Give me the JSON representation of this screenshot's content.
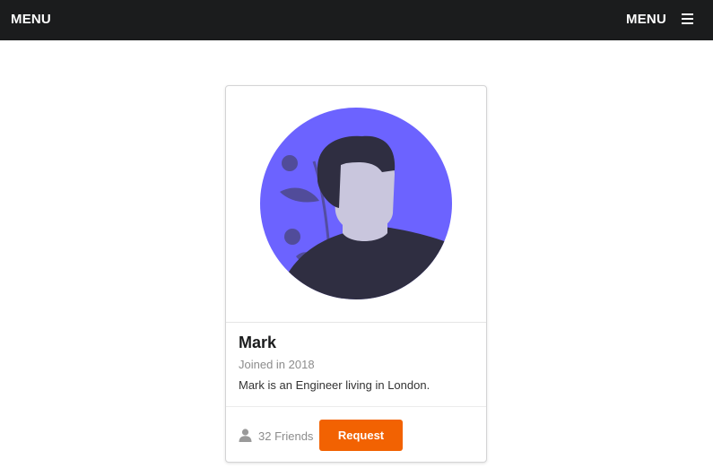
{
  "topbar": {
    "left_label": "MENU",
    "right_label": "MENU",
    "menu_icon": "hamburger-icon"
  },
  "card": {
    "avatar_icon": "person-avatar-illustration",
    "name": "Mark",
    "meta": "Joined in 2018",
    "description": "Mark is an Engineer living in London.",
    "friends_icon": "user-icon",
    "friends_text": "32 Friends",
    "request_label": "Request"
  },
  "colors": {
    "topbar_bg": "#1b1c1d",
    "avatar_bg": "#6c63ff",
    "button_bg": "#f26202"
  }
}
